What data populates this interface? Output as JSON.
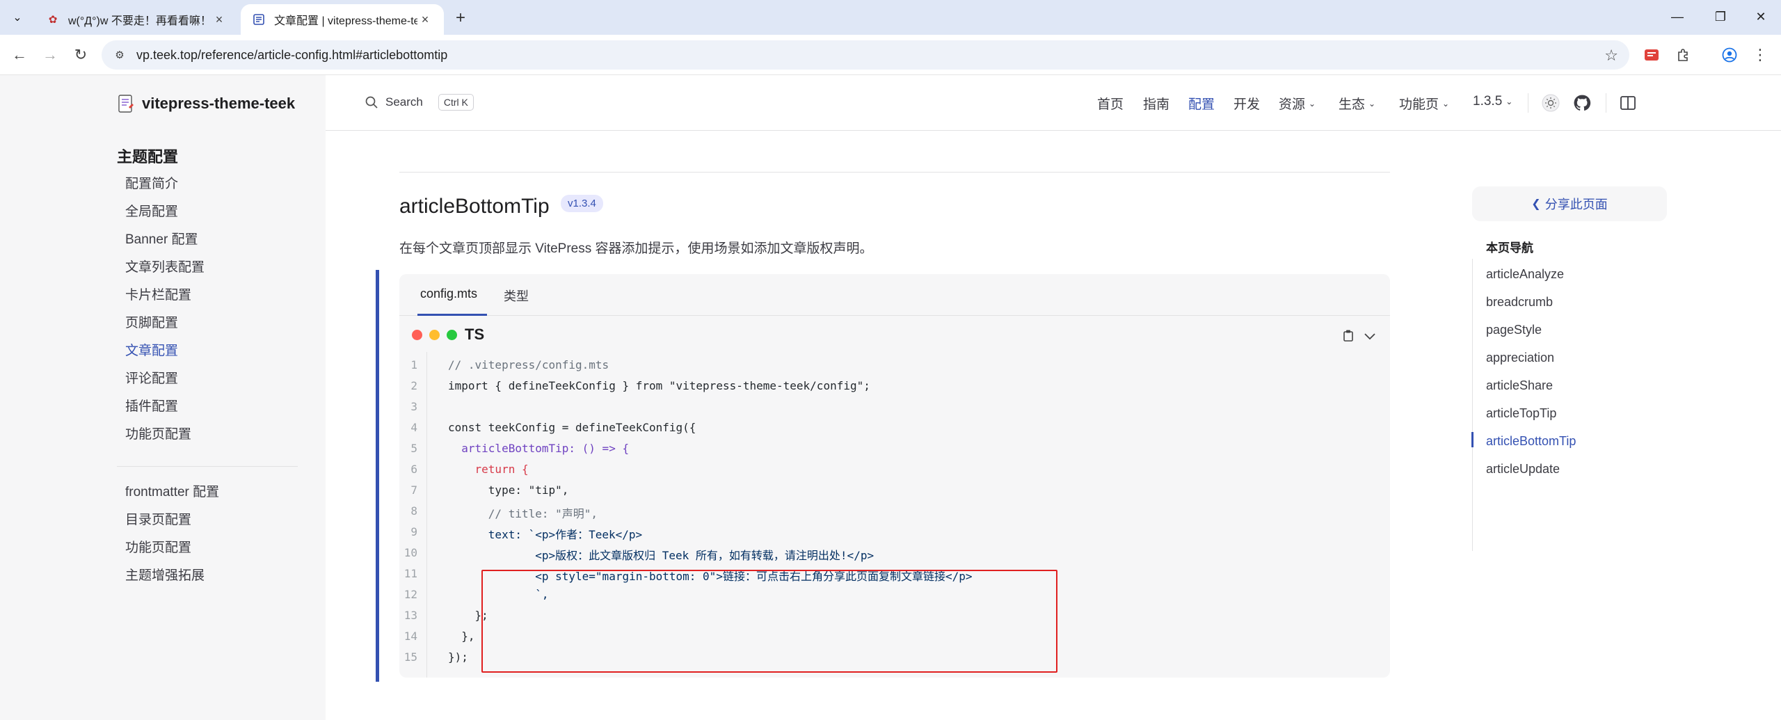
{
  "browser": {
    "tabs": [
      {
        "title": "w(°Д°)w 不要走！再看看嘛！",
        "active": false
      },
      {
        "title": "文章配置 | vitepress-theme-teek",
        "active": true
      }
    ],
    "url": "vp.teek.top/reference/article-config.html#articlebottomtip"
  },
  "header": {
    "search_label": "Search",
    "search_kbd": "Ctrl K",
    "nav": [
      {
        "label": "首页",
        "dropdown": false,
        "active": false
      },
      {
        "label": "指南",
        "dropdown": false,
        "active": false
      },
      {
        "label": "配置",
        "dropdown": false,
        "active": true
      },
      {
        "label": "开发",
        "dropdown": false,
        "active": false
      },
      {
        "label": "资源",
        "dropdown": true,
        "active": false
      },
      {
        "label": "生态",
        "dropdown": true,
        "active": false
      },
      {
        "label": "功能页",
        "dropdown": true,
        "active": false
      },
      {
        "label": "1.3.5",
        "dropdown": true,
        "active": false
      }
    ]
  },
  "sidebar": {
    "site_title": "vitepress-theme-teek",
    "section_title": "主题配置",
    "group1": [
      "配置简介",
      "全局配置",
      "Banner 配置",
      "文章列表配置",
      "卡片栏配置",
      "页脚配置",
      "文章配置",
      "评论配置",
      "插件配置",
      "功能页配置"
    ],
    "group2": [
      "frontmatter 配置",
      "目录页配置",
      "功能页配置",
      "主题增强拓展"
    ],
    "active_item": "文章配置"
  },
  "main": {
    "heading": "articleBottomTip",
    "badge": "v1.3.4",
    "description": "在每个文章页顶部显示 VitePress 容器添加提示，使用场景如添加文章版权声明。",
    "code_tabs": [
      "config.mts",
      "类型"
    ],
    "code_lang": "TS",
    "code_lines": [
      "// .vitepress/config.mts",
      "import { defineTeekConfig } from \"vitepress-theme-teek/config\";",
      "",
      "const teekConfig = defineTeekConfig({",
      "  articleBottomTip: () => {",
      "    return {",
      "      type: \"tip\",",
      "      // title: \"声明\",",
      "      text: `<p>作者：Teek</p>",
      "             <p>版权：此文章版权归 Teek 所有，如有转载，请注明出处!</p>",
      "             <p style=\"margin-bottom: 0\">链接：可点击右上角分享此页面复制文章链接</p>",
      "             `,",
      "    };",
      "  },",
      "});"
    ]
  },
  "aside": {
    "share_label": "分享此页面",
    "toc_title": "本页导航",
    "toc": [
      "articleAnalyze",
      "breadcrumb",
      "pageStyle",
      "appreciation",
      "articleShare",
      "articleTopTip",
      "articleBottomTip",
      "articleUpdate"
    ],
    "toc_active": "articleBottomTip"
  },
  "colors": {
    "brand": "#3451b2",
    "highlight_border": "#e02020"
  }
}
